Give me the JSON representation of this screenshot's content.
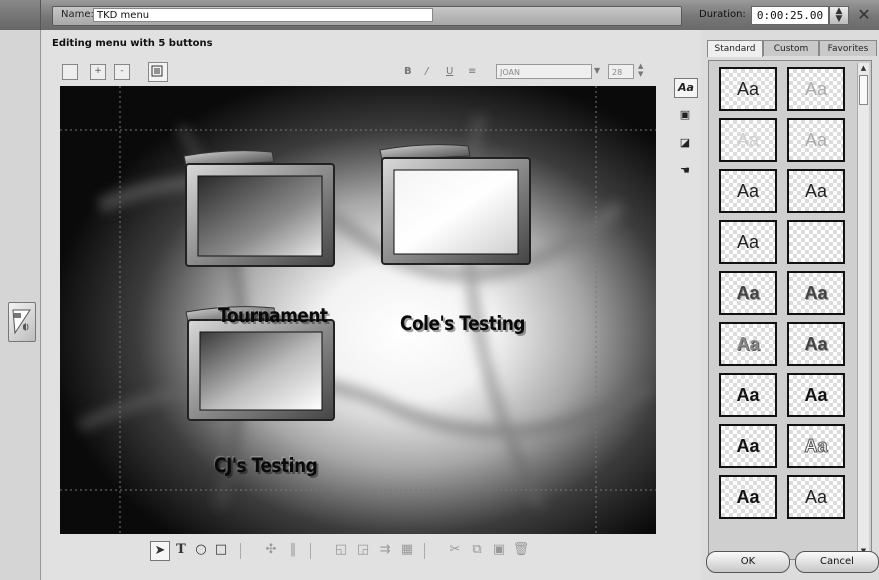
{
  "window": {
    "name_label": "Name:",
    "name_value": "TKD menu",
    "duration_label": "Duration:",
    "duration_value": "0:00:25.00"
  },
  "editor": {
    "header": "Editing menu with 5 buttons",
    "font_value": "JOAN",
    "font_size": "28"
  },
  "menu_buttons": [
    {
      "label": "Tournament"
    },
    {
      "label": "Cole's Testing"
    },
    {
      "label": "CJ's Testing"
    }
  ],
  "style_panel": {
    "tabs": [
      "Standard",
      "Custom",
      "Favorites"
    ],
    "active_tab": "Standard",
    "tile_text": "Aa",
    "tiles": [
      {
        "style": "plain"
      },
      {
        "style": "light"
      },
      {
        "style": "faint"
      },
      {
        "style": "light"
      },
      {
        "style": "plain"
      },
      {
        "style": "plain"
      },
      {
        "style": "plain"
      },
      {
        "style": "empty"
      },
      {
        "style": "bold-shadow"
      },
      {
        "style": "bold-shadow"
      },
      {
        "style": "bold-grey"
      },
      {
        "style": "bold-shadow"
      },
      {
        "style": "bold-black"
      },
      {
        "style": "bold-black"
      },
      {
        "style": "bold-black"
      },
      {
        "style": "outline"
      },
      {
        "style": "bold-black"
      },
      {
        "style": "plain"
      }
    ]
  },
  "buttons": {
    "ok": "OK",
    "cancel": "Cancel"
  },
  "icons": {
    "close": "close-icon",
    "spinner": "spinner-icon",
    "arrow_tool": "arrow-tool-icon",
    "text_tool": "text-tool-icon",
    "ellipse_tool": "ellipse-tool-icon",
    "rect_tool": "rectangle-tool-icon"
  }
}
